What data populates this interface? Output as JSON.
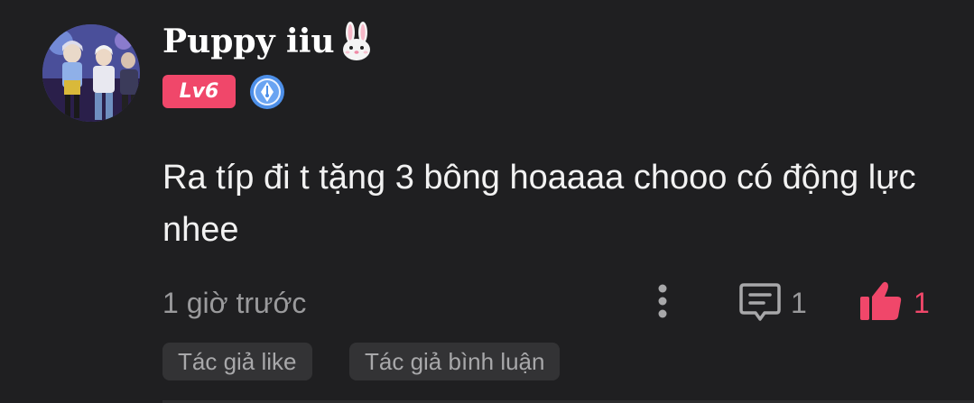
{
  "comment": {
    "username": "Puppy iiu",
    "username_emoji": "rabbit-face-icon",
    "level": "Lv6",
    "badge_icon": "pen-nib-badge-icon",
    "text": "Ra típ đi t tặng 3 bông hoaaaa chooo có động lực nhee",
    "timestamp": "1 giờ trước",
    "reply_count": "1",
    "like_count": "1",
    "tags": [
      "Tác giả like",
      "Tác giả bình luận"
    ]
  },
  "colors": {
    "background": "#1f1f21",
    "accent": "#f0476a",
    "muted_text": "#9a9a9c",
    "tag_background": "#333335"
  }
}
